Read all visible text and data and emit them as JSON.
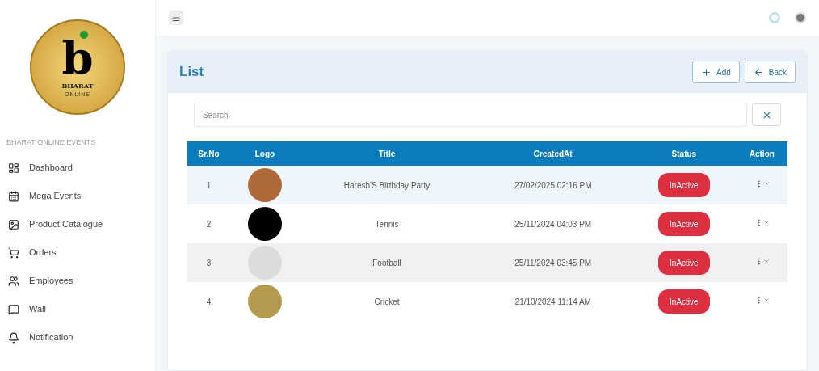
{
  "logo": {
    "letter": "b",
    "line_1": "BHARAT",
    "line_2": "ONLINE"
  },
  "sidebar": {
    "heading": "BHARAT ONLINE EVENTS",
    "items": [
      {
        "label": "Dashboard"
      },
      {
        "label": "Mega Events"
      },
      {
        "label": "Product Catalogue"
      },
      {
        "label": "Orders"
      },
      {
        "label": "Employees"
      },
      {
        "label": "Wall"
      },
      {
        "label": "Notification"
      }
    ]
  },
  "card": {
    "title": "List",
    "buttons": [
      {
        "label": "Add"
      },
      {
        "label": "Back"
      }
    ]
  },
  "search": {
    "placeholder": "Search"
  },
  "table": {
    "columns": [
      "Sr.No",
      "Logo",
      "Title",
      "CreatedAt",
      "Status",
      "Action"
    ],
    "rows": [
      {
        "sr": "1",
        "title": "Haresh'S Birthday Party",
        "created": "27/02/2025 02:16 PM",
        "status": "InActive"
      },
      {
        "sr": "2",
        "title": "Tennis",
        "created": "25/11/2024 04:03 PM",
        "status": "InActive"
      },
      {
        "sr": "3",
        "title": "Football",
        "created": "25/11/2024 03:45 PM",
        "status": "InActive"
      },
      {
        "sr": "4",
        "title": "Cricket",
        "created": "21/10/2024 11:14 AM",
        "status": "InActive"
      }
    ]
  }
}
